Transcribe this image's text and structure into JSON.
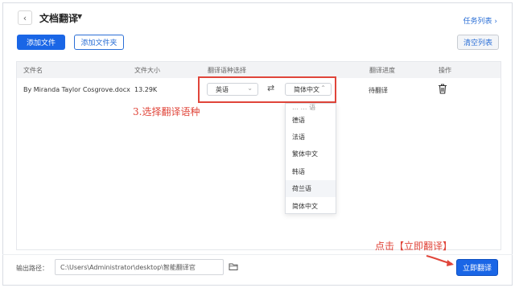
{
  "header": {
    "back_glyph": "‹",
    "title": "文档翻译",
    "title_caret": "▼",
    "task_list_link": "任务列表 ›"
  },
  "toolbar": {
    "add_file": "添加文件",
    "add_folder": "添加文件夹",
    "clear_list": "清空列表"
  },
  "table": {
    "headers": {
      "file_name": "文件名",
      "file_size": "文件大小",
      "lang_select": "翻译语种选择",
      "progress": "翻译进度",
      "actions": "操作"
    },
    "rows": [
      {
        "file_name": "By Miranda Taylor Cosgrove.docx",
        "file_size": "13.29K",
        "source_lang": "英语",
        "target_lang": "简体中文",
        "progress": "待翻译"
      }
    ]
  },
  "dropdown": {
    "clipped_top": "… … 语",
    "options": [
      "德语",
      "法语",
      "繁体中文",
      "韩语",
      "荷兰语",
      "简体中文"
    ],
    "hovered_index": 4
  },
  "annotations": {
    "step_select_lang": "3.选择翻译语种",
    "click_translate": "点击【立即翻译】"
  },
  "footer": {
    "output_path_label": "输出路径：",
    "output_path_value": "C:\\Users\\Administrator\\desktop\\智能翻译官",
    "translate_now": "立即翻译"
  },
  "colors": {
    "accent": "#1a66e6",
    "annotation_red": "#e0453a",
    "header_bg": "#f2f3f5"
  }
}
